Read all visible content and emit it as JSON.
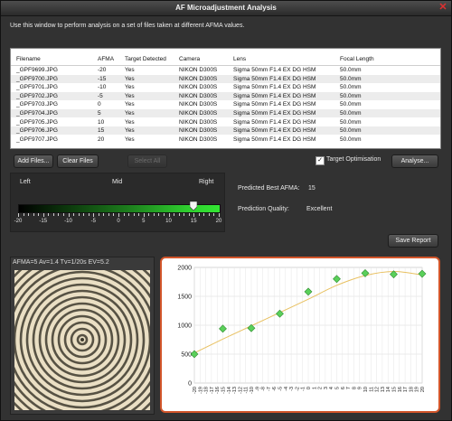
{
  "window": {
    "title": "AF Microadjustment Analysis"
  },
  "intro": "Use this window to perform analysis on a set of files taken at different AFMA values.",
  "table": {
    "columns": [
      "Filename",
      "AFMA",
      "Target Detected",
      "Camera",
      "Lens",
      "Focal Length"
    ],
    "rows": [
      [
        "_GPF9699.JPG",
        "-20",
        "Yes",
        "NIKON D300S",
        "Sigma 50mm F1.4 EX DG HSM",
        "50.0mm"
      ],
      [
        "_GPF9700.JPG",
        "-15",
        "Yes",
        "NIKON D300S",
        "Sigma 50mm F1.4 EX DG HSM",
        "50.0mm"
      ],
      [
        "_GPF9701.JPG",
        "-10",
        "Yes",
        "NIKON D300S",
        "Sigma 50mm F1.4 EX DG HSM",
        "50.0mm"
      ],
      [
        "_GPF9702.JPG",
        "-5",
        "Yes",
        "NIKON D300S",
        "Sigma 50mm F1.4 EX DG HSM",
        "50.0mm"
      ],
      [
        "_GPF9703.JPG",
        "0",
        "Yes",
        "NIKON D300S",
        "Sigma 50mm F1.4 EX DG HSM",
        "50.0mm"
      ],
      [
        "_GPF9704.JPG",
        "5",
        "Yes",
        "NIKON D300S",
        "Sigma 50mm F1.4 EX DG HSM",
        "50.0mm"
      ],
      [
        "_GPF9705.JPG",
        "10",
        "Yes",
        "NIKON D300S",
        "Sigma 50mm F1.4 EX DG HSM",
        "50.0mm"
      ],
      [
        "_GPF9706.JPG",
        "15",
        "Yes",
        "NIKON D300S",
        "Sigma 50mm F1.4 EX DG HSM",
        "50.0mm"
      ],
      [
        "_GPF9707.JPG",
        "20",
        "Yes",
        "NIKON D300S",
        "Sigma 50mm F1.4 EX DG HSM",
        "50.0mm"
      ]
    ]
  },
  "buttons": {
    "add_files": "Add Files...",
    "clear_files": "Clear Files",
    "select_all": "Select All",
    "analyse": "Analyse...",
    "save_report": "Save Report"
  },
  "target_optimisation": {
    "label": "Target Optimisation",
    "checked": true
  },
  "slider": {
    "left_label": "Left",
    "mid_label": "Mid",
    "right_label": "Right",
    "value": 15,
    "min": -20,
    "max": 20,
    "tick_labels": [
      "-20",
      "-15",
      "-10",
      "-5",
      "0",
      "5",
      "10",
      "15",
      "20"
    ]
  },
  "results": {
    "best_afma_label": "Predicted Best AFMA:",
    "best_afma_value": "15",
    "quality_label": "Prediction Quality:",
    "quality_value": "Excellent"
  },
  "photo": {
    "caption": "AFMA=5  Av=1.4  Tv=1/20s  EV=5.2"
  },
  "colors": {
    "accent": "#d2552a",
    "point": "#5ad05a",
    "curve": "#e8c060",
    "slider_green": "#33e633"
  },
  "chart_data": {
    "type": "scatter",
    "x": [
      -20,
      -15,
      -10,
      -5,
      0,
      5,
      10,
      15,
      20
    ],
    "y": [
      500,
      940,
      950,
      1200,
      1580,
      1800,
      1900,
      1880,
      1890
    ],
    "fit": {
      "x": [
        -20,
        -15,
        -10,
        -5,
        0,
        5,
        10,
        15,
        20
      ],
      "y": [
        520,
        760,
        990,
        1220,
        1450,
        1690,
        1860,
        1930,
        1870
      ]
    },
    "xlim": [
      -20,
      20
    ],
    "ylim": [
      0,
      2000
    ],
    "yticks": [
      0,
      500,
      1000,
      1500,
      2000
    ],
    "xticks": [
      -20,
      -19,
      -18,
      -17,
      -16,
      -15,
      -14,
      -13,
      -12,
      -11,
      -10,
      -9,
      -8,
      -7,
      -6,
      -5,
      -4,
      -3,
      -2,
      -1,
      0,
      1,
      2,
      3,
      4,
      5,
      6,
      7,
      8,
      9,
      10,
      11,
      12,
      13,
      14,
      15,
      16,
      17,
      18,
      19,
      20
    ],
    "grid": true
  }
}
